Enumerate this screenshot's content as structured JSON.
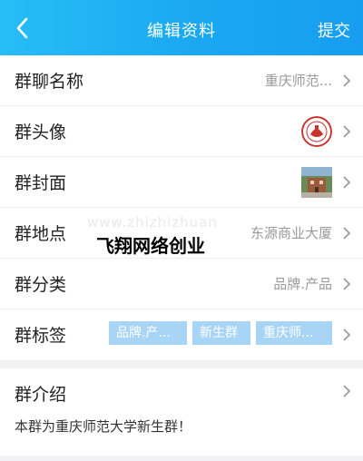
{
  "nav": {
    "title": "编辑资料",
    "submit_label": "提交",
    "back_icon": "chevron-left-icon"
  },
  "rows": {
    "name": {
      "label": "群聊名称",
      "value": "重庆师范..."
    },
    "avatar": {
      "label": "群头像"
    },
    "cover": {
      "label": "群封面"
    },
    "location": {
      "label": "群地点",
      "value": "东源商业大厦"
    },
    "category": {
      "label": "群分类",
      "value": "品牌.产品"
    },
    "tags": {
      "label": "群标签",
      "items": [
        "品牌.产...",
        "新生群",
        "重庆师..."
      ]
    }
  },
  "overlay": {
    "watermark": "www.zhizhizhuan",
    "headline": "飞翔网络创业"
  },
  "intro": {
    "label": "群介绍",
    "text": "本群为重庆师范大学新生群！"
  },
  "colors": {
    "nav_start": "#27bdf6",
    "nav_end": "#179ef0",
    "tag_bg": "#a8d5f6",
    "avatar_red": "#c8322c"
  }
}
